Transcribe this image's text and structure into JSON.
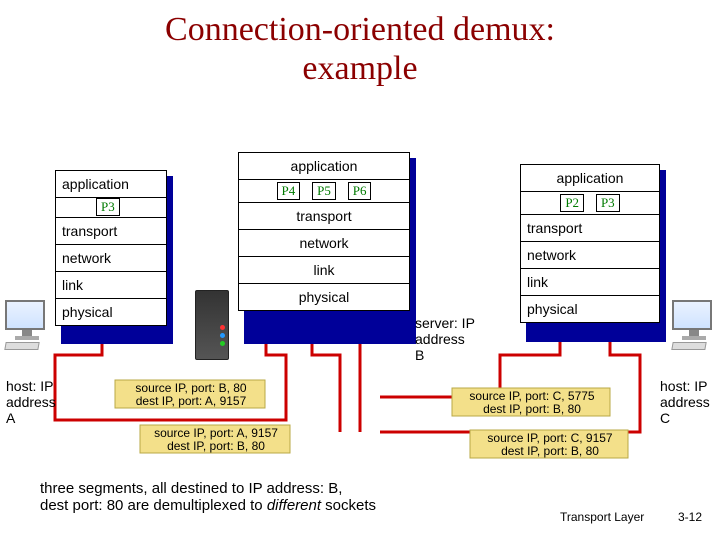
{
  "title_line1": "Connection-oriented demux:",
  "title_line2": "example",
  "stacks": {
    "left": {
      "app": "application",
      "process": "P3",
      "transport": "transport",
      "network": "network",
      "link": "link",
      "physical": "physical"
    },
    "center": {
      "app": "application",
      "p4": "P4",
      "p5": "P5",
      "p6": "P6",
      "transport": "transport",
      "network": "network",
      "link": "link",
      "physical": "physical"
    },
    "right": {
      "app": "application",
      "p2": "P2",
      "p3": "P3",
      "transport": "transport",
      "network": "network",
      "link": "link",
      "physical": "physical"
    }
  },
  "hosts": {
    "a": {
      "label_l1": "host: IP",
      "label_l2": "address",
      "label_l3": "A"
    },
    "b": {
      "label_l1": "server: IP",
      "label_l2": "address",
      "label_l3": "B"
    },
    "c": {
      "label_l1": "host: IP",
      "label_l2": "address",
      "label_l3": "C"
    }
  },
  "packets": {
    "ba": {
      "l1": "source IP, port: B, 80",
      "l2": "dest IP, port: A, 9157"
    },
    "ab": {
      "l1": "source IP, port: A, 9157",
      "l2": "dest IP,  port: B, 80"
    },
    "bc": {
      "l1": "source IP, port: C, 5775",
      "l2": "dest IP, port: B, 80"
    },
    "cb": {
      "l1": "source IP, port: C, 9157",
      "l2": "dest IP, port: B, 80"
    }
  },
  "caption": {
    "l1": "three segments, all destined to IP address: B,",
    "l2_a": " dest port: 80 are demultiplexed to ",
    "l2_b": "different",
    "l2_c": " sockets"
  },
  "footer": "Transport Layer",
  "slide_no": "3-12"
}
